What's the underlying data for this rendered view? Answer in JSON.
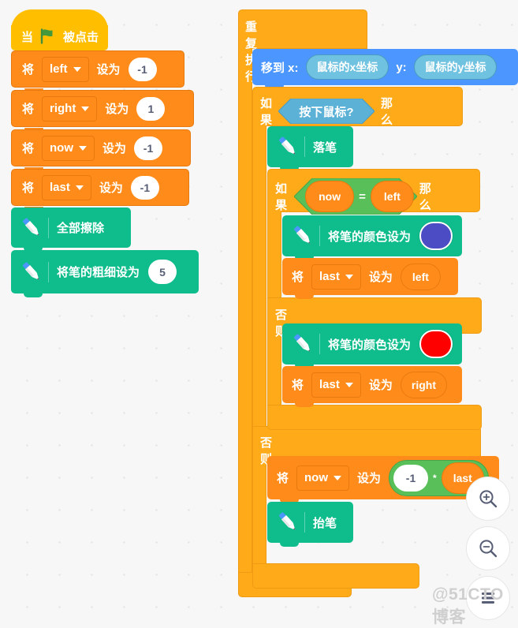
{
  "canvas": {
    "background_color": "#f7f7f7",
    "grid_dot_color": "#e0e0e0",
    "watermark": "@51CTO博客"
  },
  "palette": {
    "events": "#FFBF00",
    "variables": "#FF8C1A",
    "pen": "#0FBD8C",
    "motion": "#4C97FF",
    "control": "#FFAB19",
    "operators": "#59C059",
    "sensing": "#5CB1D6",
    "pen_color_purple": "#4C4CC4",
    "pen_color_red": "#FF0000"
  },
  "script_left": {
    "hat": {
      "prefix": "当",
      "icon": "green-flag-icon",
      "suffix": "被点击"
    },
    "blocks": [
      {
        "set_label": "将",
        "variable": "left",
        "to_label": "设为",
        "value": "-1"
      },
      {
        "set_label": "将",
        "variable": "right",
        "to_label": "设为",
        "value": "1"
      },
      {
        "set_label": "将",
        "variable": "now",
        "to_label": "设为",
        "value": "-1"
      },
      {
        "set_label": "将",
        "variable": "last",
        "to_label": "设为",
        "value": "-1"
      }
    ],
    "pen_blocks": [
      {
        "label": "全部擦除",
        "icon": "pen-icon"
      },
      {
        "label": "将笔的粗细设为",
        "icon": "pen-icon",
        "value": "5"
      }
    ]
  },
  "script_right": {
    "forever": {
      "label": "重复执行",
      "loop_icon": "loop-arrow-icon"
    },
    "goto_xy": {
      "prefix": "移到 x:",
      "x_reporter": "鼠标的x坐标",
      "mid_label": "y:",
      "y_reporter": "鼠标的y坐标"
    },
    "if_mouse": {
      "if_label": "如果",
      "condition": "按下鼠标?",
      "then_label": "那么",
      "else_label": "否则"
    },
    "pen_down": {
      "label": "落笔",
      "icon": "pen-icon"
    },
    "pen_up": {
      "label": "抬笔",
      "icon": "pen-icon"
    },
    "if_equal": {
      "if_label": "如果",
      "left_operand": "now",
      "operator": "=",
      "right_operand": "left",
      "then_label": "那么",
      "else_label": "否则"
    },
    "set_pen_color_a": {
      "label": "将笔的颜色设为",
      "icon": "pen-icon",
      "color": "#4C4CC4"
    },
    "set_last_left": {
      "set_label": "将",
      "variable": "last",
      "to_label": "设为",
      "value": "left"
    },
    "set_pen_color_b": {
      "label": "将笔的颜色设为",
      "icon": "pen-icon",
      "color": "#FF0000"
    },
    "set_last_right": {
      "set_label": "将",
      "variable": "last",
      "to_label": "设为",
      "value": "right"
    },
    "set_now_mult": {
      "set_label": "将",
      "variable": "now",
      "to_label": "设为",
      "operand_left": "-1",
      "operator": "*",
      "operand_right": "last"
    }
  },
  "zoom_controls": {
    "zoom_in": "zoom-in-icon",
    "zoom_out": "zoom-out-icon",
    "zoom_reset": "zoom-reset-icon"
  }
}
